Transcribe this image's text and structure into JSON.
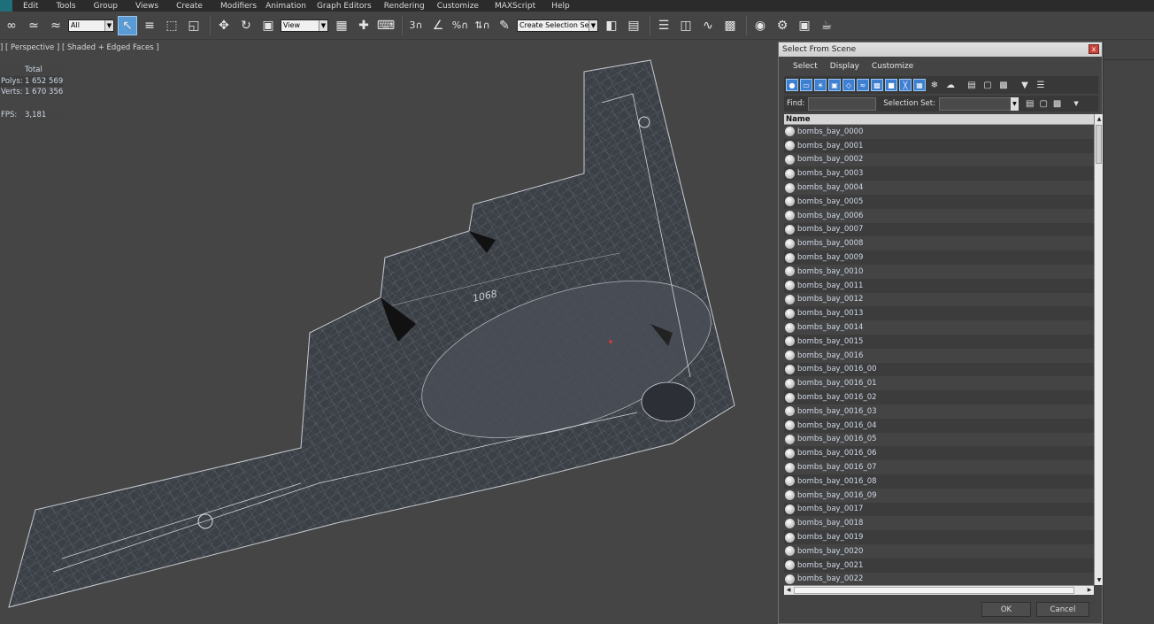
{
  "menu": [
    "Edit",
    "Tools",
    "Group",
    "Views",
    "Create",
    "Modifiers",
    "Animation",
    "Graph Editors",
    "Rendering",
    "Customize",
    "MAXScript",
    "Help"
  ],
  "toolbar": {
    "selection_filter": "All",
    "reference_coord": "View",
    "named_selection": "Create Selection Se",
    "icons": [
      "link-icon",
      "unlink-icon",
      "bind-spacewarp-icon",
      "select-object-icon",
      "select-by-name-icon",
      "rect-selection-icon",
      "window-crossing-icon",
      "move-icon",
      "rotate-icon",
      "scale-icon",
      "select-manipulate-icon",
      "use-pivot-icon",
      "keyboard-shortcut-icon",
      "snap-3d-icon",
      "angle-snap-icon",
      "percent-snap-icon",
      "spinner-snap-icon",
      "edit-named-selection-icon",
      "mirror-icon",
      "align-icon",
      "layer-manager-icon",
      "scene-explorer-icon",
      "curve-editor-icon",
      "schematic-view-icon",
      "material-editor-icon",
      "render-setup-icon",
      "rendered-frame-icon",
      "render-icon"
    ]
  },
  "viewport": {
    "label": "] [ Perspective ] [ Shaded + Edged Faces ]",
    "stats": {
      "header": "Total",
      "rows": [
        {
          "key": "Polys:",
          "value": "1 652 569"
        },
        {
          "key": "Verts:",
          "value": "1 670 356"
        }
      ],
      "fps_key": "FPS:",
      "fps_value": "3,181"
    },
    "model_text": "1068"
  },
  "dialog": {
    "title": "Select From Scene",
    "close": "x",
    "menu": [
      "Select",
      "Display",
      "Customize"
    ],
    "find_label": "Find:",
    "find_value": "",
    "selection_set_label": "Selection Set:",
    "selection_set_value": "",
    "column_header": "Name",
    "items": [
      "bombs_bay_0000",
      "bombs_bay_0001",
      "bombs_bay_0002",
      "bombs_bay_0003",
      "bombs_bay_0004",
      "bombs_bay_0005",
      "bombs_bay_0006",
      "bombs_bay_0007",
      "bombs_bay_0008",
      "bombs_bay_0009",
      "bombs_bay_0010",
      "bombs_bay_0011",
      "bombs_bay_0012",
      "bombs_bay_0013",
      "bombs_bay_0014",
      "bombs_bay_0015",
      "bombs_bay_0016",
      "bombs_bay_0016_00",
      "bombs_bay_0016_01",
      "bombs_bay_0016_02",
      "bombs_bay_0016_03",
      "bombs_bay_0016_04",
      "bombs_bay_0016_05",
      "bombs_bay_0016_06",
      "bombs_bay_0016_07",
      "bombs_bay_0016_08",
      "bombs_bay_0016_09",
      "bombs_bay_0017",
      "bombs_bay_0018",
      "bombs_bay_0019",
      "bombs_bay_0020",
      "bombs_bay_0021",
      "bombs_bay_0022"
    ],
    "ok": "OK",
    "cancel": "Cancel"
  }
}
